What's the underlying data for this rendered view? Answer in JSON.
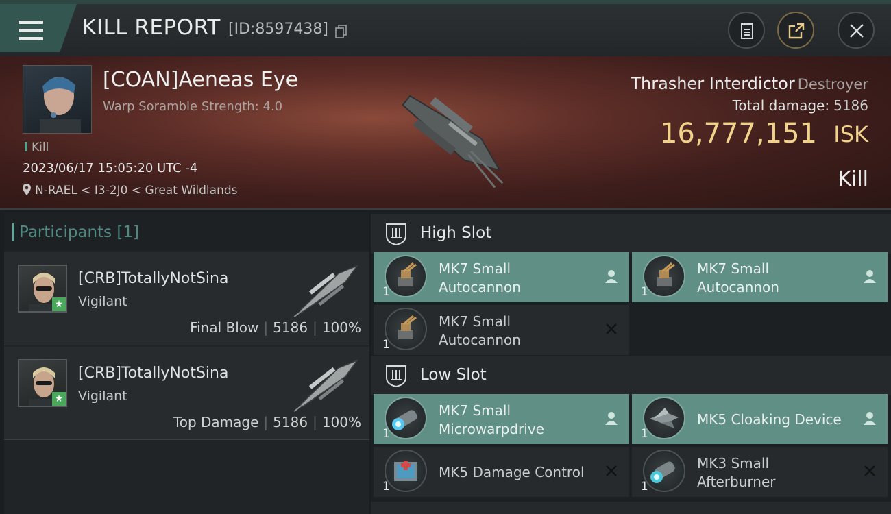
{
  "header": {
    "title": "KILL REPORT",
    "id_text": "[ID:8597438]",
    "buttons": [
      "clipboard-icon",
      "share-icon",
      "close-icon"
    ]
  },
  "victim": {
    "name": "[COAN]Aeneas Eye",
    "subtitle": "Warp Soramble Strength: 4.0",
    "tag": "Kill",
    "datetime": "2023/06/17 15:05:20 UTC -4",
    "location": "N-RAEL < I3-2J0 < Great Wildlands",
    "ship": "Thrasher Interdictor",
    "ship_class": "Destroyer",
    "total_damage_label": "Total damage:",
    "total_damage": "5186",
    "isk_value": "16,777,151",
    "isk_unit": "ISK",
    "result": "Kill"
  },
  "participants": {
    "title": "Participants [1]",
    "items": [
      {
        "name": "[CRB]TotallyNotSina",
        "ship": "Vigilant",
        "role": "Final Blow",
        "damage": "5186",
        "percent": "100%"
      },
      {
        "name": "[CRB]TotallyNotSina",
        "ship": "Vigilant",
        "role": "Top Damage",
        "damage": "5186",
        "percent": "100%"
      }
    ]
  },
  "slots": {
    "high": {
      "title": "High Slot",
      "modules": [
        {
          "name": "MK7 Small\nAutocannon",
          "qty": "1",
          "status": "person-icon"
        },
        {
          "name": "MK7 Small\nAutocannon",
          "qty": "1",
          "status": "person-icon"
        },
        {
          "name": "MK7 Small\nAutocannon",
          "qty": "1",
          "status": "x-icon"
        }
      ]
    },
    "low": {
      "title": "Low Slot",
      "modules": [
        {
          "name": "MK7 Small\nMicrowarpdrive",
          "qty": "1",
          "status": "person-icon"
        },
        {
          "name": "MK5 Cloaking Device",
          "qty": "1",
          "status": "person-icon"
        },
        {
          "name": "MK5 Damage Control",
          "qty": "1",
          "status": "x-icon"
        },
        {
          "name": "MK3 Small\nAfterburner",
          "qty": "1",
          "status": "x-icon"
        }
      ]
    }
  },
  "colors": {
    "accent": "#5f8f85",
    "isk": "#f0d28a",
    "banner": "#5e2e28"
  }
}
